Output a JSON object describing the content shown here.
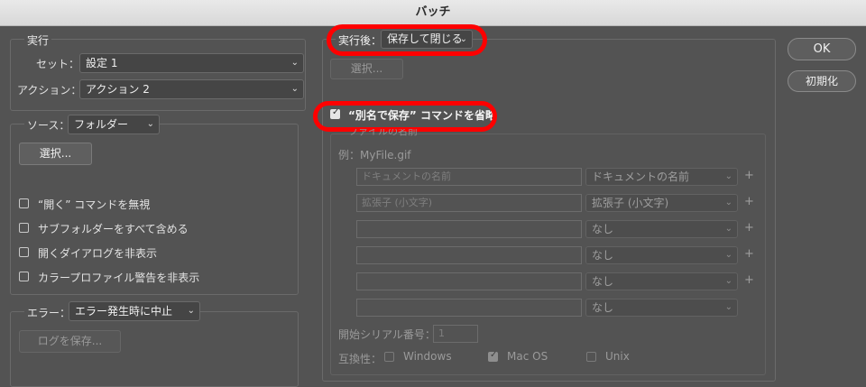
{
  "window": {
    "title": "バッチ"
  },
  "run": {
    "legend": "実行",
    "set_label": "セット：",
    "set_value": "設定 1",
    "action_label": "アクション：",
    "action_value": "アクション 2"
  },
  "source": {
    "label": "ソース：",
    "value": "フォルダー",
    "choose_label": "選択...",
    "options": [
      {
        "label": "“開く” コマンドを無視",
        "checked": false
      },
      {
        "label": "サブフォルダーをすべて含める",
        "checked": false
      },
      {
        "label": "開くダイアログを非表示",
        "checked": false
      },
      {
        "label": "カラープロファイル警告を非表示",
        "checked": false
      }
    ]
  },
  "error": {
    "label": "エラー：",
    "value": "エラー発生時に中止",
    "save_log_label": "ログを保存..."
  },
  "destination": {
    "label": "実行後：",
    "value": "保存して閉じる",
    "choose_label": "選択...",
    "override_label": "“別名で保存” コマンドを省略",
    "override_checked": true,
    "file_naming_legend": "ファイルの名前",
    "example": "例：MyFile.gif",
    "naming_rows": [
      {
        "placeholder": "ドキュメントの名前",
        "select": "ドキュメントの名前",
        "plus": "+"
      },
      {
        "placeholder": "拡張子 (小文字)",
        "select": "拡張子 (小文字)",
        "plus": "+"
      },
      {
        "placeholder": "",
        "select": "なし",
        "plus": "+"
      },
      {
        "placeholder": "",
        "select": "なし",
        "plus": "+"
      },
      {
        "placeholder": "",
        "select": "なし",
        "plus": "+"
      },
      {
        "placeholder": "",
        "select": "なし",
        "plus": ""
      }
    ],
    "serial_label": "開始シリアル番号：",
    "serial_value": "1",
    "compat_label": "互換性：",
    "compat": [
      {
        "label": "Windows",
        "checked": false
      },
      {
        "label": "Mac OS",
        "checked": true
      },
      {
        "label": "Unix",
        "checked": false
      }
    ]
  },
  "buttons": {
    "ok": "OK",
    "reset": "初期化"
  },
  "colors": {
    "highlight": "#ff0000",
    "background": "#535353"
  }
}
